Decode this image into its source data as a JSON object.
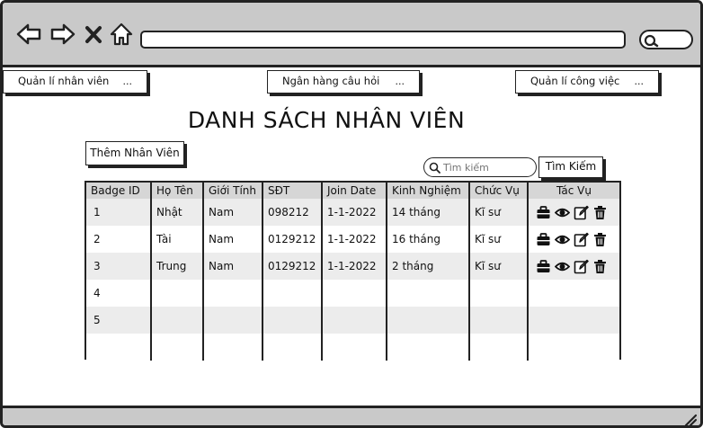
{
  "browser": {
    "nav_icons": [
      "back-arrow-icon",
      "forward-arrow-icon",
      "close-x-icon",
      "home-icon"
    ],
    "search_icon": "search-icon",
    "status_icon": "resize-grip-icon"
  },
  "menu": {
    "employee_mgmt": {
      "label": "Quản lí nhân viên",
      "more": "..."
    },
    "question_bank": {
      "label": "Ngân hàng câu hỏi",
      "more": "..."
    },
    "task_mgmt": {
      "label": "Quản lí công việc",
      "more": "..."
    }
  },
  "page": {
    "title": "DANH SÁCH NHÂN VIÊN",
    "add_button": "Thêm Nhân Viên",
    "search_placeholder": "Tìm kiếm",
    "search_button": "Tìm Kiếm"
  },
  "table": {
    "columns": [
      "Badge ID",
      "Họ Tên",
      "Giới Tính",
      "SĐT",
      "Join Date",
      "Kinh Nghiệm",
      "Chức Vụ",
      "Tác Vụ"
    ],
    "rows": [
      {
        "id": "1",
        "name": "Nhật",
        "gender": "Nam",
        "phone": "098212",
        "join": "1-1-2022",
        "exp": "14 tháng",
        "role": "Kĩ sư",
        "has_actions": true
      },
      {
        "id": "2",
        "name": "Tài",
        "gender": "Nam",
        "phone": "0129212",
        "join": "1-1-2022",
        "exp": "16 tháng",
        "role": "Kĩ sư",
        "has_actions": true
      },
      {
        "id": "3",
        "name": "Trung",
        "gender": "Nam",
        "phone": "0129212",
        "join": "1-1-2022",
        "exp": "2 tháng",
        "role": "Kĩ sư",
        "has_actions": true
      },
      {
        "id": "4",
        "name": "",
        "gender": "",
        "phone": "",
        "join": "",
        "exp": "",
        "role": "",
        "has_actions": false
      },
      {
        "id": "5",
        "name": "",
        "gender": "",
        "phone": "",
        "join": "",
        "exp": "",
        "role": "",
        "has_actions": false
      },
      {
        "id": "",
        "name": "",
        "gender": "",
        "phone": "",
        "join": "",
        "exp": "",
        "role": "",
        "has_actions": false
      }
    ],
    "action_icons": [
      "briefcase-icon",
      "eye-icon",
      "edit-icon",
      "trash-icon"
    ]
  }
}
